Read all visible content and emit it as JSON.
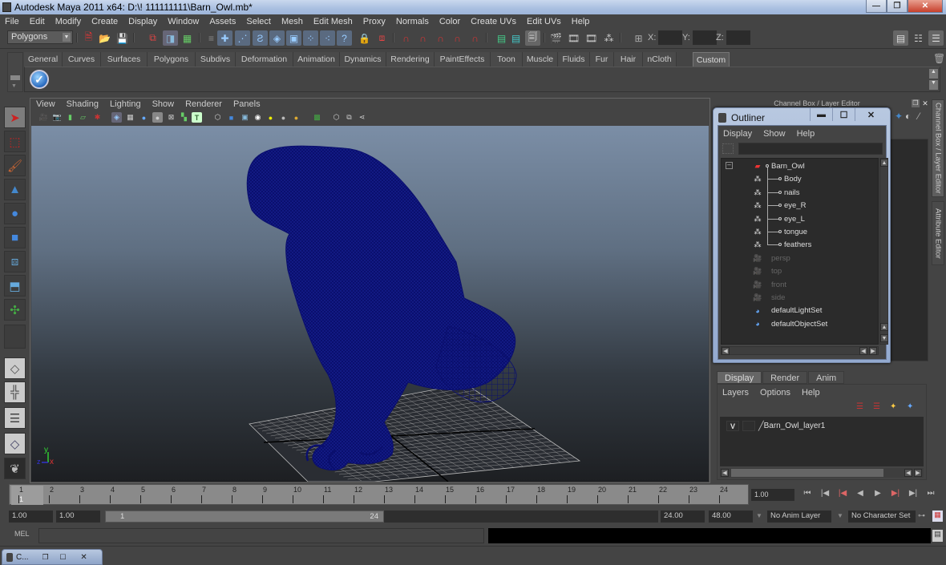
{
  "window": {
    "title": "Autodesk Maya 2011 x64: D:\\! 111111111\\Barn_Owl.mb*",
    "controls": {
      "minimize": "—",
      "maximize": "❐",
      "close": "✕"
    }
  },
  "menubar": [
    "File",
    "Edit",
    "Modify",
    "Create",
    "Display",
    "Window",
    "Assets",
    "Select",
    "Mesh",
    "Edit Mesh",
    "Proxy",
    "Normals",
    "Color",
    "Create UVs",
    "Edit UVs",
    "Help"
  ],
  "statusline": {
    "mode": "Polygons",
    "x_label": "X:",
    "y_label": "Y:",
    "z_label": "Z:",
    "x_value": "",
    "y_value": "",
    "z_value": ""
  },
  "shelf": {
    "tabs": [
      "General",
      "Curves",
      "Surfaces",
      "Polygons",
      "Subdivs",
      "Deformation",
      "Animation",
      "Dynamics",
      "Rendering",
      "PaintEffects",
      "Toon",
      "Muscle",
      "Fluids",
      "Fur",
      "Hair",
      "nCloth",
      "Custom"
    ],
    "active_tab": "Custom"
  },
  "viewport": {
    "menu": [
      "View",
      "Shading",
      "Lighting",
      "Show",
      "Renderer",
      "Panels"
    ],
    "axis": {
      "y": "y",
      "x": "x",
      "z": "z"
    },
    "colors": {
      "wireframe": "#0a0f6e",
      "grid": "#c8c8c8"
    }
  },
  "channel_box": {
    "header": "Channel Box / Layer Editor",
    "side_tabs": [
      "Channel Box / Layer Editor",
      "Attribute Editor"
    ]
  },
  "outliner": {
    "title": "Outliner",
    "menu": [
      "Display",
      "Show",
      "Help"
    ],
    "search_value": "",
    "items": [
      {
        "label": "Barn_Owl",
        "type": "group",
        "depth": 0,
        "dim": false
      },
      {
        "label": "Body",
        "type": "mesh",
        "depth": 1,
        "dim": false
      },
      {
        "label": "nails",
        "type": "mesh",
        "depth": 1,
        "dim": false
      },
      {
        "label": "eye_R",
        "type": "mesh",
        "depth": 1,
        "dim": false
      },
      {
        "label": "eye_L",
        "type": "mesh",
        "depth": 1,
        "dim": false
      },
      {
        "label": "tongue",
        "type": "mesh",
        "depth": 1,
        "dim": false
      },
      {
        "label": "feathers",
        "type": "mesh",
        "depth": 1,
        "dim": false
      },
      {
        "label": "persp",
        "type": "camera",
        "depth": 0,
        "dim": true
      },
      {
        "label": "top",
        "type": "camera",
        "depth": 0,
        "dim": true
      },
      {
        "label": "front",
        "type": "camera",
        "depth": 0,
        "dim": true
      },
      {
        "label": "side",
        "type": "camera",
        "depth": 0,
        "dim": true
      },
      {
        "label": "defaultLightSet",
        "type": "set",
        "depth": 0,
        "dim": false
      },
      {
        "label": "defaultObjectSet",
        "type": "set",
        "depth": 0,
        "dim": false
      }
    ]
  },
  "layer_editor": {
    "tabs": [
      "Display",
      "Render",
      "Anim"
    ],
    "active_tab": "Display",
    "menu": [
      "Layers",
      "Options",
      "Help"
    ],
    "layers": [
      {
        "visible": "V",
        "name": "Barn_Owl_layer1"
      }
    ]
  },
  "timeline": {
    "frames": [
      "1",
      "2",
      "3",
      "4",
      "5",
      "6",
      "7",
      "8",
      "9",
      "10",
      "11",
      "12",
      "13",
      "14",
      "15",
      "16",
      "17",
      "18",
      "19",
      "20",
      "21",
      "22",
      "23",
      "24"
    ],
    "current_frame_label": "1",
    "current_time": "1.00",
    "playback_buttons": [
      "⏮",
      "|◀",
      "|◀",
      "◀",
      "▶",
      "▶|",
      "▶|",
      "⏭"
    ]
  },
  "range": {
    "start_time": "1.00",
    "playback_start": "1.00",
    "range_start_label": "1",
    "range_end_label": "24",
    "playback_end": "24.00",
    "end_time": "48.00",
    "anim_layer": "No Anim Layer",
    "character_set": "No Character Set"
  },
  "command_line": {
    "label": "MEL",
    "input_value": "",
    "output_value": ""
  },
  "minimized_window": {
    "label": "C..."
  }
}
